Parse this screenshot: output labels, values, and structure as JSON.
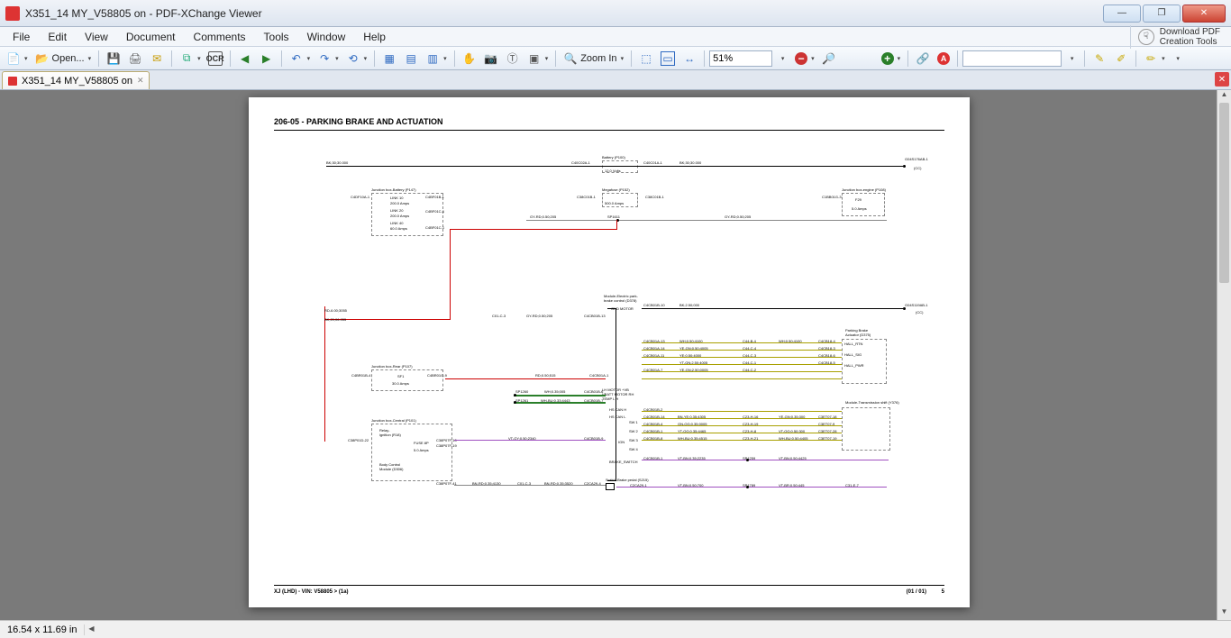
{
  "window": {
    "title": "X351_14 MY_V58805 on - PDF-XChange Viewer"
  },
  "menu": {
    "file": "File",
    "edit": "Edit",
    "view": "View",
    "document": "Document",
    "comments": "Comments",
    "tools": "Tools",
    "window": "Window",
    "help": "Help",
    "download": "Download PDF\nCreation Tools"
  },
  "toolbar": {
    "open": "Open...",
    "ocr": "OCR",
    "zoom_in": "Zoom In",
    "zoom_pct": "51%"
  },
  "tab": {
    "name": "X351_14 MY_V58805 on"
  },
  "status": {
    "page_size": "16.54 x 11.69 in"
  },
  "doc": {
    "section": "206-05 - PARKING BRAKE AND ACTUATION",
    "footer_left": "XJ  (LHD) - VIN: V58805 >   (1a)",
    "footer_right_page": "(01 / 01)",
    "footer_right_num": "5",
    "labels": {
      "battery": "Battery (P100)",
      "battery_v": "12.0 Volts",
      "jb_batt": "Junction box-Battery (P147)",
      "link10": "LINK 10",
      "link10a": "200.0 Amps",
      "link20": "LINK 20",
      "link20a": "200.0 Amps",
      "link40": "LINK 40",
      "link40a": "60.0 Amps",
      "mega": "Megafuse (P152)",
      "mega_a": "500.0 Amps",
      "jb_eng": "Junction box-engine (P108)",
      "f29": "F29",
      "f29a": "5.0 Amps",
      "mod_epb": "Module-Electric park-\nbrake control (D378)",
      "gnd_motor": "GND MOTOR",
      "pba": "Parking Brake\nActuator (D375)",
      "hall_rtn": "HALL_RTN",
      "hall_sig": "HALL_SIG",
      "hall_pwr": "HALL_PWR",
      "mts": "Module-Transmission shift (Y376)",
      "jb_rear": "Junction box-Rear (P107)",
      "sf1": "SF1",
      "sf1a": "30.0 Amps",
      "jb_cen": "Junction box-Central (P101)",
      "relay": "Relay-\nignition (R18)",
      "fuse8p": "FUSE 8P",
      "fuse8p_a": "5.0 Amps",
      "bcm": "Body Control\nModule (D306)",
      "switch_brake": "Switch-Brake pedal (S215)",
      "lh_motor": "LH MOTOR +VB\nVBATT MOTOR RH\nTEMP L H",
      "hs_can_h": "HS CAN H",
      "hs_can_l": "HS CAN L",
      "sw1": "SW 1",
      "sw2": "SW 2",
      "sw3": "SW 3",
      "sw4": "SW 4",
      "ign": "IGN",
      "brake_sw": "BRAKE_SWITCH",
      "cc": "(CC)",
      "wires": {
        "bk1": "BK;30;30.000",
        "c40c02a1": "C40C02A-1",
        "c40c01a1": "C40C01A-1",
        "gyrd": "GY-RD;0.50;205",
        "sp1611": "SP1611",
        "c40f10a1": "C4DF10A-1",
        "c40f01b1": "C4BF01B-1",
        "c40f01c1": "C4BF01C-1",
        "c38c01b1": "C38C01B-1",
        "c1bb01g3": "C1BB01G-3",
        "g04s176ab1": "G04S176AB-1",
        "g04s119ab1": "G04S119AB-1",
        "c4cb01b10": "C4CB01B-10",
        "c4cb01b13": "C4CB01B-13",
        "bk250": "BK;2.50;000",
        "wh050": "WH;0.50;4100",
        "yegn050": "YE-GN;0.50;4005",
        "ye050": "YE;0.50;4000",
        "ytgn250": "YT-GN;2.50;4005",
        "yegn2250": "YE-GN;2.50;0005",
        "c44b4": "C44-B-4",
        "c44c4": "C44-C-4",
        "c44c3": "C44-C-3",
        "c44c1": "C44-C-1",
        "c44c2": "C44-C-2",
        "c4cb184": "C4CB18-4",
        "c4cb183": "C4CB18-3",
        "c4cb186": "C4CB18-6",
        "c4cb185": "C4CB18-5",
        "sp1260": "SP1260",
        "sp1261": "SP1261",
        "wh035": "WH;0.35;005",
        "whbu033": "WH-BU;0.33;4443",
        "c4cb01b6": "C4CB01B-6",
        "c4cb01b7": "C4CB01B-7",
        "c4cb01b2": "C4CB01B-2",
        "bnye035": "BN-YE;0.35;4305",
        "gnog035": "GN-OG;0.35;0005",
        "ytog035": "YT-OG;0.35;4465",
        "whbu035": "WH-BU;0.35;4515",
        "c23h11": "C23-H-11",
        "c23h16": "C23-H-16",
        "c23h19": "C23-H-19",
        "c23h8": "C23-H-8",
        "c23h21": "C23-H-21",
        "yegn035": "YE-GN;0.35;300",
        "gn035": "GN-OG;0.35;005",
        "vtog050": "VT-OG;0.50;300",
        "whbu0352": "WH-BU;0.50;4405",
        "c3et0718": "C3ET07-18",
        "c3et079": "C3ET07-9",
        "c3et0728": "C3ET07-28",
        "c3et0719": "C3ET07-19",
        "rd050": "RD;0.50;515",
        "c4cb01a1": "C4CB01A-1",
        "c4br01b4": "C4BR01B-4",
        "c4br01g9": "C4BR01G-9",
        "c38p01d22": "C38P01D-22",
        "rd6": "RD-6.00;3055",
        "bk206": "BK;20;06.055",
        "c38p07f10": "C38P07F-10",
        "c38p07f19": "C38P07F-19",
        "vtgy050": "VT-GY;0.50;2340",
        "c4cb01b9": "C4CB01B-9",
        "c4cb01b14": "C4CB01B-14",
        "c4cb01b4": "C4CB01B-4",
        "c4cb01b1": "C4CB01B-1",
        "c4cb01b8": "C4CB01B-8",
        "c38p07f41": "C38P07F-41",
        "bnrd035": "BN-RD;0.35;4130",
        "c01c3": "C01-C-3",
        "bnrd0352": "BN-RD;0.35;3520",
        "c2ca294": "C2CA29-4",
        "c2ca291": "C2CA29-1",
        "vtbn050": "VT-BN;0.50;700",
        "sp1789": "SP1789",
        "vtbr050": "VT-BR;0.50;445",
        "c31e7": "C31-E-7",
        "c4cb01b1b": "C4CB01B-1",
        "vtbn035": "VT-BN;0.35;2235",
        "sp1259": "SP1259",
        "vtbn0502": "VT-BN;0.50;4425",
        "c4cb01a7": "C4CB01A-7",
        "c4cb01a14": "C4CB01A-14",
        "c4cb01a13": "C4CB01A-13",
        "c4cb01a11": "C4CB01A-11"
      }
    }
  }
}
